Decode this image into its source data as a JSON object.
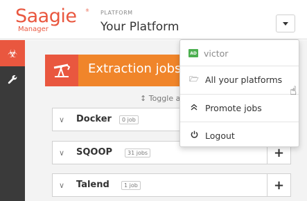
{
  "header": {
    "logo_text": "Saagie",
    "logo_sub": "Manager",
    "logo_reg": "®",
    "platform_label": "PLATFORM",
    "platform_name": "Your Platform",
    "toggle_icon": "caret-down-icon"
  },
  "sidebar": {
    "items": [
      {
        "icon": "biohazard-icon",
        "glyph": "☣",
        "active": true
      },
      {
        "icon": "wrench-icon",
        "glyph": "🔧",
        "active": false
      }
    ]
  },
  "main": {
    "banner_title": "Extraction jobs",
    "banner_icon": "oil-pump-icon",
    "toggle_all": "↕ Toggle all",
    "groups": [
      {
        "name": "Docker",
        "count": "0 job"
      },
      {
        "name": "SQOOP",
        "count": "31 jobs"
      },
      {
        "name": "Talend",
        "count": "1 job"
      }
    ],
    "add_label": "+"
  },
  "dropdown": {
    "user_initials": "AD",
    "user_name": "victor",
    "items": [
      {
        "label": "All your platforms",
        "icon": "folder-open-icon",
        "glyph": "🗁"
      },
      {
        "label": "Promote jobs",
        "icon": "double-chevron-up-icon",
        "glyph": "≈"
      },
      {
        "label": "Logout",
        "icon": "power-icon",
        "glyph": "⏻"
      }
    ]
  },
  "colors": {
    "brand": "#e9573f",
    "banner": "#f0852a",
    "sidebar": "#3a3a3a",
    "avatar": "#4caf50"
  }
}
